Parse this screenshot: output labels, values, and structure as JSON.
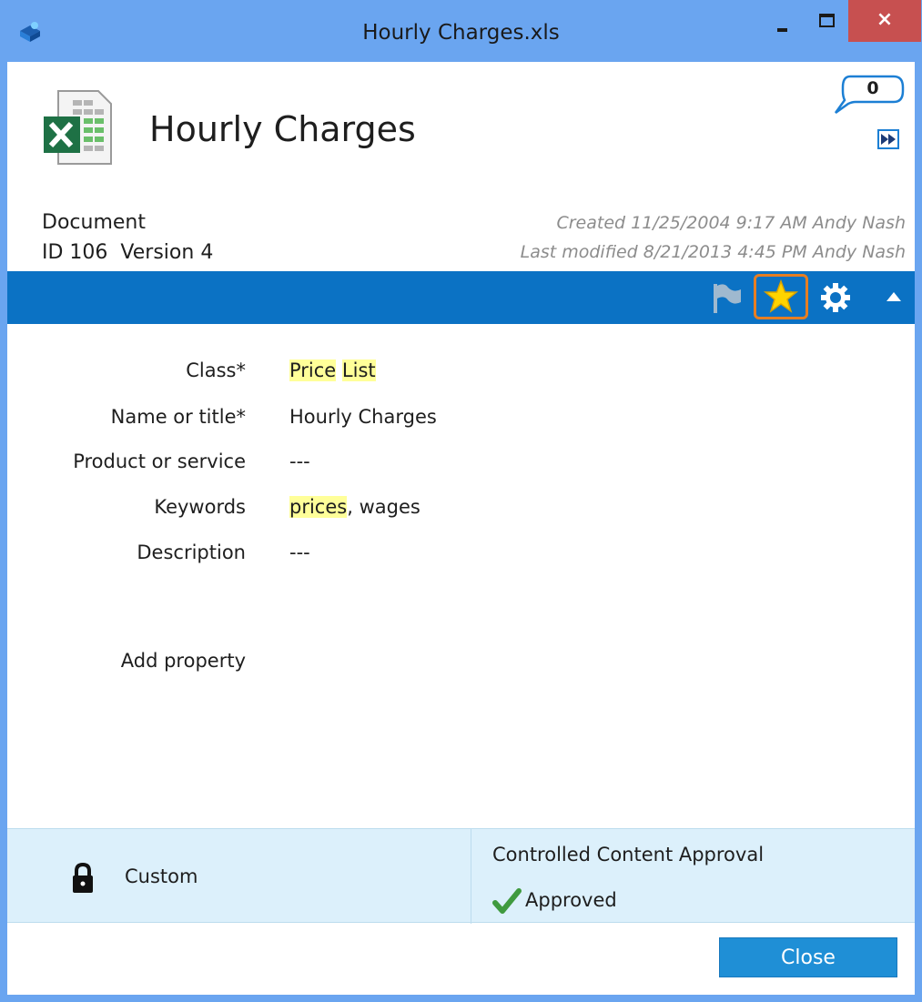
{
  "window": {
    "title": "Hourly Charges.xls",
    "close_glyph": "×"
  },
  "header": {
    "doc_title": "Hourly Charges",
    "comment_count": "0",
    "object_type": "Document",
    "id_text": "ID 106",
    "version_text": "Version 4",
    "created": "Created 11/25/2004 9:17 AM Andy Nash",
    "last_modified": "Last modified 8/21/2013 4:45 PM Andy Nash"
  },
  "toolbar": {
    "icons": [
      "flag-icon",
      "star-icon",
      "gear-icon",
      "collapse-arrow-icon"
    ],
    "accent": "#0b72c4",
    "highlight_border": "#e67e22"
  },
  "properties": [
    {
      "label": "Class*",
      "value_parts": [
        "Price",
        "List"
      ]
    },
    {
      "label": "Name or title*",
      "value": "Hourly Charges"
    },
    {
      "label": "Product or service",
      "value": "---"
    },
    {
      "label": "Keywords",
      "value_highlight": "prices",
      "value_rest": ", wages"
    },
    {
      "label": "Description",
      "value": "---"
    }
  ],
  "add_property": "Add property",
  "footer": {
    "permission": "Custom",
    "workflow": "Controlled Content Approval",
    "workflow_state": "Approved"
  },
  "close_button": "Close"
}
